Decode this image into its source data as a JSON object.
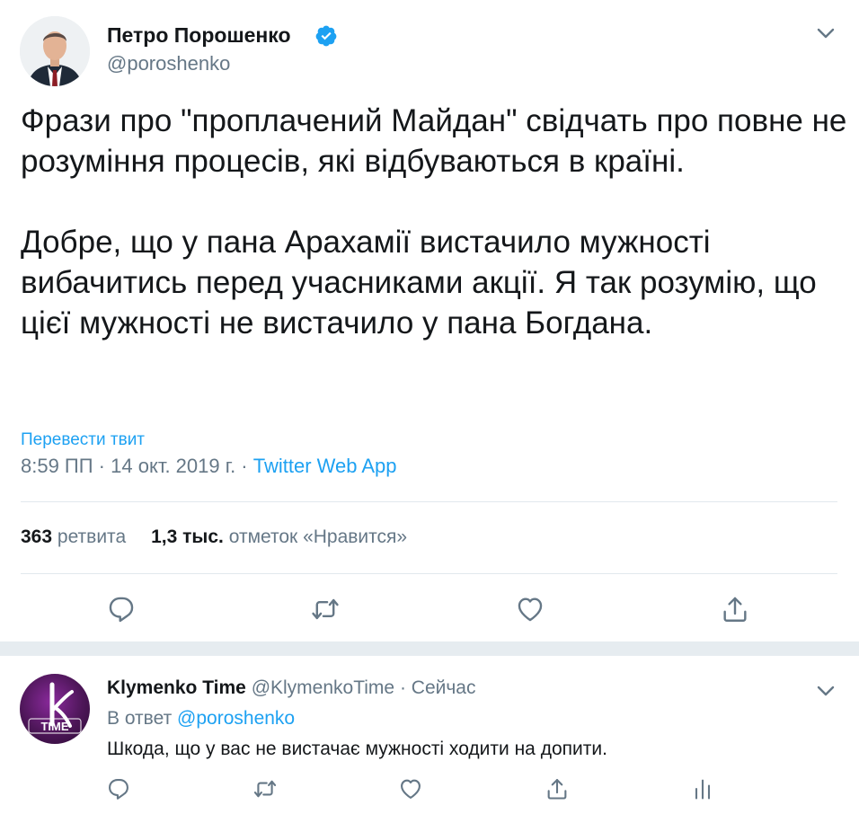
{
  "tweet": {
    "author": {
      "name": "Петро Порошенко",
      "handle": "@poroshenko",
      "verified": true
    },
    "text_paragraphs": [
      "Фрази про \"проплачений Майдан\" свідчать про повне не розуміння процесів, які відбуваються в країні.",
      "Добре, що у пана Арахамії вистачило мужності вибачитись перед учасниками акції. Я так розумію, що цієї мужності не вистачило у пана Богдана."
    ],
    "translate_label": "Перевести твит",
    "time": "8:59 ПП",
    "date": "14 окт. 2019 г.",
    "separator": " · ",
    "source": "Twitter Web App",
    "stats": {
      "retweets_count": "363",
      "retweets_label": "ретвита",
      "likes_count": "1,3 тыс.",
      "likes_label": "отметок «Нравится»"
    }
  },
  "reply": {
    "author": {
      "name": "Klymenko Time",
      "handle": "@KlymenkoTime",
      "time": "Сейчас"
    },
    "header_separator": " · ",
    "in_reply_prefix": "В ответ ",
    "in_reply_mention": "@poroshenko",
    "text": "Шкода, що у вас не вистачає мужності ходити на допити.",
    "avatar_text": "TIME"
  },
  "colors": {
    "accent": "#1da1f2",
    "text_primary": "#14171a",
    "text_secondary": "#657786",
    "icon": "#657786",
    "divider": "#e1e8ed",
    "separator_band": "#e6ecf0"
  },
  "icons": {
    "verified": "verified-badge-icon",
    "caret": "chevron-down-icon",
    "reply": "reply-icon",
    "retweet": "retweet-icon",
    "like": "heart-icon",
    "share": "share-icon",
    "analytics": "analytics-icon"
  }
}
